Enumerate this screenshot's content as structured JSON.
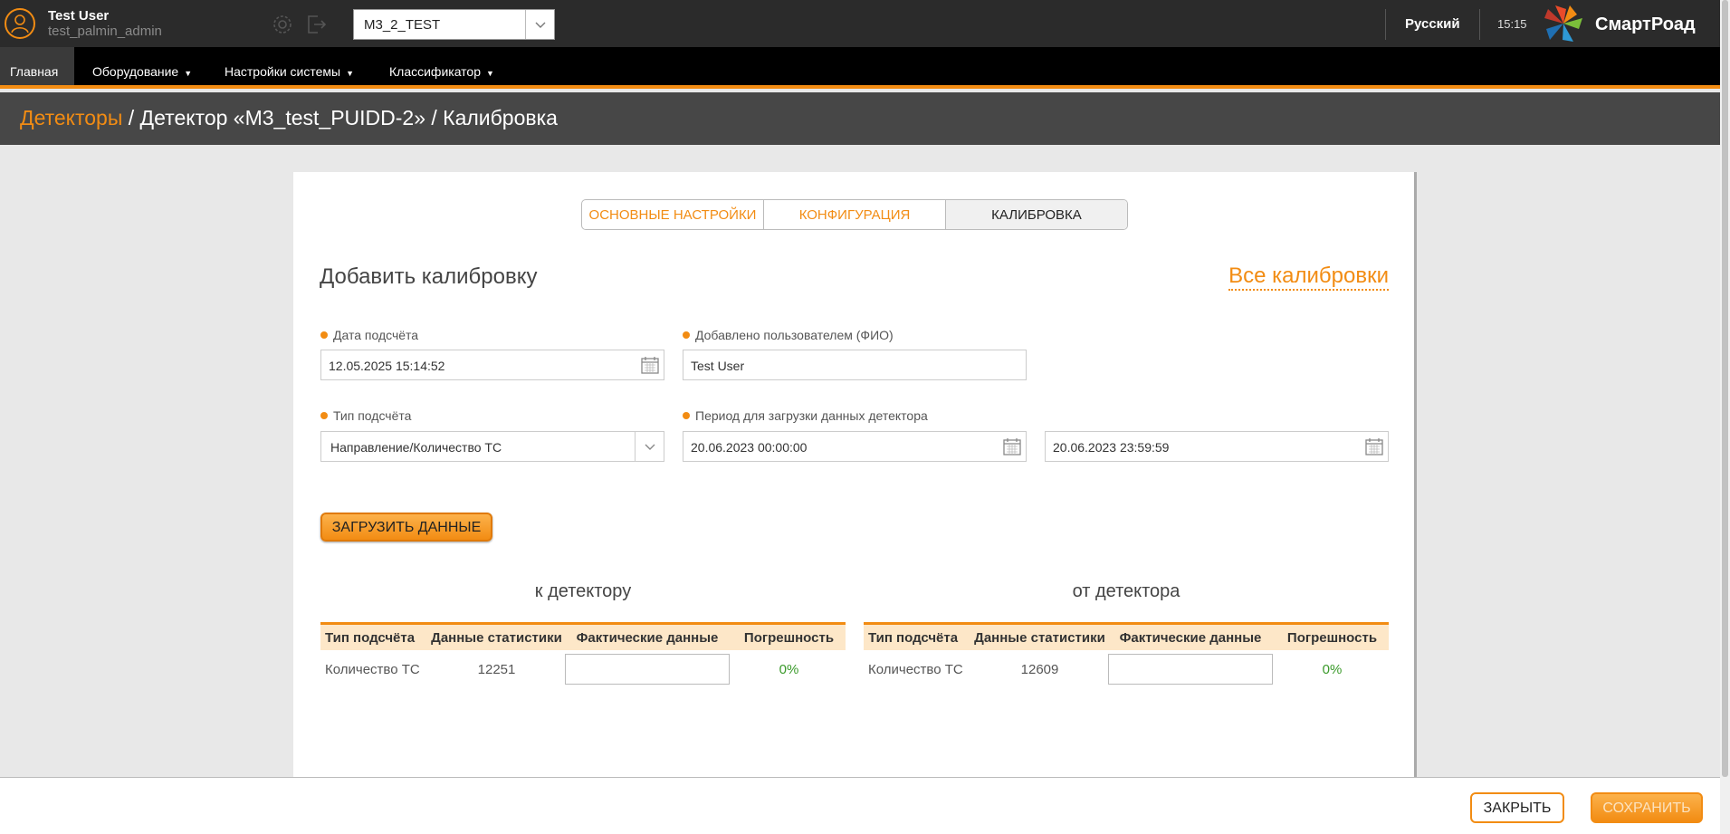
{
  "user": {
    "name": "Test User",
    "login": "test_palmin_admin"
  },
  "top": {
    "project_select": "M3_2_TEST",
    "language": "Русский",
    "time": "15:15",
    "brand": "СмартРоад"
  },
  "menu": {
    "items": [
      {
        "label": "Главная"
      },
      {
        "label": "Оборудование"
      },
      {
        "label": "Настройки системы"
      },
      {
        "label": "Классификатор"
      }
    ]
  },
  "breadcrumb": {
    "root": "Детекторы",
    "rest": " / Детектор «M3_test_PUIDD-2» / Калибровка"
  },
  "tabs": [
    "ОСНОВНЫЕ НАСТРОЙКИ",
    "КОНФИГУРАЦИЯ",
    "КАЛИБРОВКА"
  ],
  "form": {
    "title": "Добавить калибровку",
    "all_link": "Все калибровки",
    "count_date_label": "Дата подсчёта",
    "count_date_value": "12.05.2025 15:14:52",
    "added_by_label": "Добавлено пользователем (ФИО)",
    "added_by_value": "Test User",
    "count_type_label": "Тип подсчёта",
    "count_type_value": "Направление/Количество ТС",
    "period_label": "Период для загрузки данных детектора",
    "period_from": "20.06.2023 00:00:00",
    "period_to": "20.06.2023 23:59:59",
    "load_button": "ЗАГРУЗИТЬ ДАННЫЕ"
  },
  "to_detector": {
    "title": "к детектору",
    "headers": [
      "Тип подсчёта",
      "Данные статистики",
      "Фактические данные",
      "Погрешность"
    ],
    "row": {
      "type": "Количество ТС",
      "stats": "12251",
      "actual": "",
      "error": "0%"
    }
  },
  "from_detector": {
    "title": "от детектора",
    "headers": [
      "Тип подсчёта",
      "Данные статистики",
      "Фактические данные",
      "Погрешность"
    ],
    "row": {
      "type": "Количество ТС",
      "stats": "12609",
      "actual": "",
      "error": "0%"
    }
  },
  "footer": {
    "close": "ЗАКРЫТЬ",
    "save": "СОХРАНИТЬ"
  },
  "colors": {
    "accent": "#f28c13",
    "topbar": "#2b2b2b",
    "crumbbar": "#474747",
    "success": "#3a9a2a"
  }
}
